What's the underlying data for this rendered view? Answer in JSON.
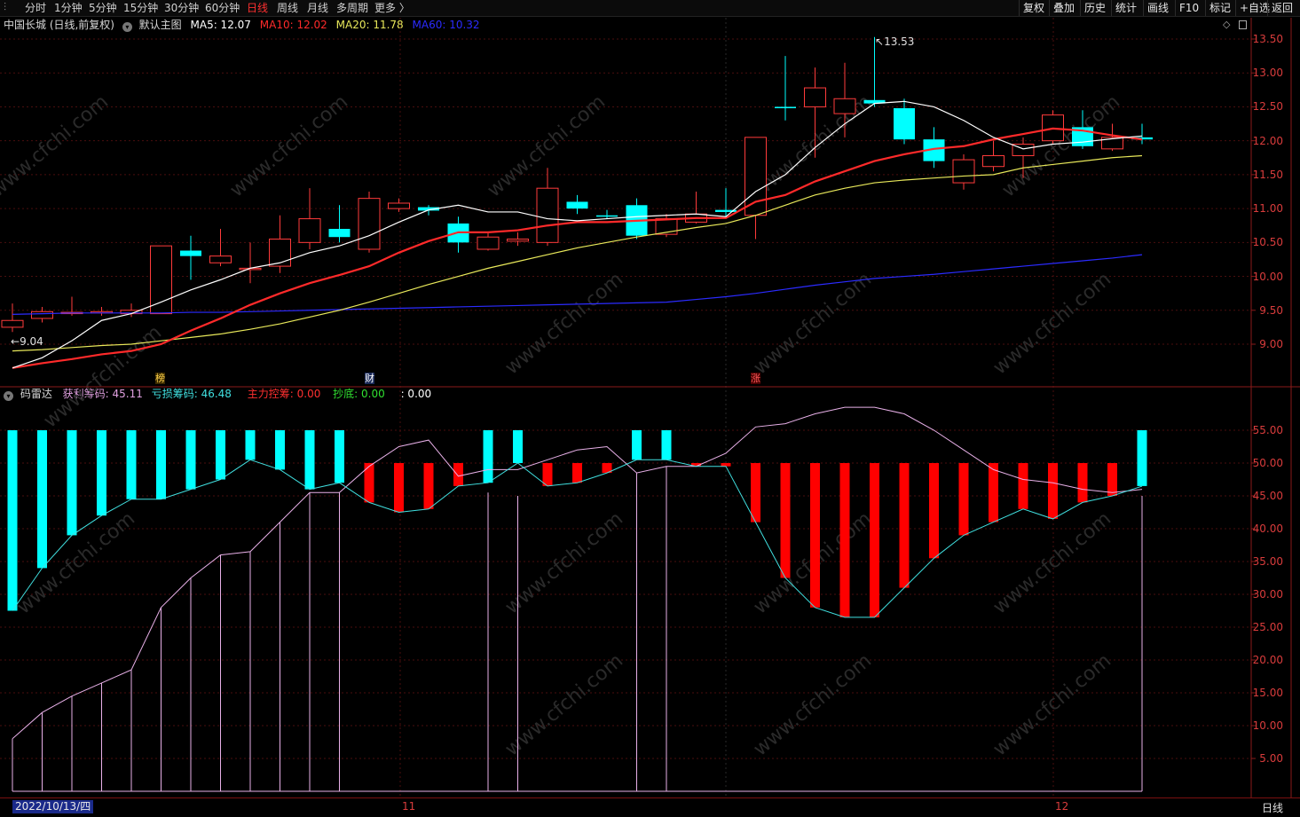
{
  "toolbar": {
    "left_items": [
      "分时",
      "1分钟",
      "5分钟",
      "15分钟",
      "30分钟",
      "60分钟",
      "日线",
      "周线",
      "月线",
      "多周期",
      "更多 〉"
    ],
    "active_period": "日线",
    "right_items": [
      "复权",
      "叠加",
      "历史",
      "统计",
      "画线",
      "F10",
      "标记",
      "+自选",
      "返回"
    ]
  },
  "main_panel": {
    "title": "中国长城 (日线,前复权)",
    "template": "默认主图",
    "ma": [
      {
        "label": "MA5: 12.07",
        "color": "#ffffff"
      },
      {
        "label": "MA10: 12.02",
        "color": "#ff2a2a"
      },
      {
        "label": "MA20: 11.78",
        "color": "#e8e85a"
      },
      {
        "label": "MA60: 10.32",
        "color": "#2b2bff"
      }
    ],
    "high_label": "13.53",
    "low_label": "9.04",
    "markers": [
      "榜",
      "财",
      "涨"
    ],
    "y_ticks": [
      "13.50",
      "13.00",
      "12.50",
      "12.00",
      "11.50",
      "11.00",
      "10.50",
      "10.00",
      "9.50",
      "9.00"
    ]
  },
  "sub_panel": {
    "title": "码雷达",
    "items": [
      {
        "label": "获利筹码: 45.11",
        "color": "#e0a0e0"
      },
      {
        "label": "亏损筹码: 46.48",
        "color": "#40e0e0"
      },
      {
        "label": "主力控筹: 0.00",
        "color": "#ff3030"
      },
      {
        "label": "抄底: 0.00",
        "color": "#30e030"
      },
      {
        "label": ": 0.00",
        "color": "#ffffff"
      }
    ],
    "y_ticks": [
      "55.00",
      "50.00",
      "45.00",
      "40.00",
      "35.00",
      "30.00",
      "25.00",
      "20.00",
      "15.00",
      "10.00",
      "5.00"
    ]
  },
  "bottom_bar": {
    "date": "2022/10/13/四",
    "month_11": "11",
    "month_12": "12",
    "period": "日线"
  },
  "watermark": "www.cfchi.com",
  "colors": {
    "up": "#ff3b3b",
    "down": "#00ffff",
    "grid": "#4a0e0e",
    "axis": "#8a1a1a"
  },
  "chart_data": {
    "type": "candlestick",
    "price_ylim": [
      8.6,
      13.7
    ],
    "candles": [
      {
        "o": 9.25,
        "c": 9.35,
        "h": 9.6,
        "l": 9.18
      },
      {
        "o": 9.38,
        "c": 9.48,
        "h": 9.55,
        "l": 9.32
      },
      {
        "o": 9.46,
        "c": 9.47,
        "h": 9.7,
        "l": 9.42
      },
      {
        "o": 9.46,
        "c": 9.48,
        "h": 9.55,
        "l": 9.42
      },
      {
        "o": 9.45,
        "c": 9.5,
        "h": 9.6,
        "l": 9.4
      },
      {
        "o": 9.45,
        "c": 10.45,
        "h": 10.45,
        "l": 9.45
      },
      {
        "o": 10.38,
        "c": 10.3,
        "h": 10.6,
        "l": 9.95
      },
      {
        "o": 10.2,
        "c": 10.3,
        "h": 10.7,
        "l": 10.15
      },
      {
        "o": 10.1,
        "c": 10.12,
        "h": 10.5,
        "l": 9.9
      },
      {
        "o": 10.15,
        "c": 10.55,
        "h": 10.9,
        "l": 10.05
      },
      {
        "o": 10.5,
        "c": 10.85,
        "h": 11.3,
        "l": 10.4
      },
      {
        "o": 10.7,
        "c": 10.58,
        "h": 11.05,
        "l": 10.5
      },
      {
        "o": 10.4,
        "c": 11.15,
        "h": 11.25,
        "l": 10.35
      },
      {
        "o": 11.0,
        "c": 11.08,
        "h": 11.15,
        "l": 10.95
      },
      {
        "o": 11.02,
        "c": 10.97,
        "h": 11.05,
        "l": 10.9
      },
      {
        "o": 10.78,
        "c": 10.5,
        "h": 10.88,
        "l": 10.35
      },
      {
        "o": 10.4,
        "c": 10.58,
        "h": 10.65,
        "l": 10.38
      },
      {
        "o": 10.52,
        "c": 10.55,
        "h": 10.65,
        "l": 10.45
      },
      {
        "o": 10.5,
        "c": 11.3,
        "h": 11.6,
        "l": 10.45
      },
      {
        "o": 11.1,
        "c": 11.0,
        "h": 11.2,
        "l": 10.92
      },
      {
        "o": 10.9,
        "c": 10.88,
        "h": 10.98,
        "l": 10.85
      },
      {
        "o": 11.05,
        "c": 10.6,
        "h": 11.15,
        "l": 10.55
      },
      {
        "o": 10.62,
        "c": 10.85,
        "h": 10.92,
        "l": 10.58
      },
      {
        "o": 10.8,
        "c": 10.92,
        "h": 11.25,
        "l": 10.78
      },
      {
        "o": 10.98,
        "c": 10.95,
        "h": 11.3,
        "l": 10.85
      },
      {
        "o": 10.9,
        "c": 12.05,
        "h": 12.05,
        "l": 10.55
      },
      {
        "o": 12.5,
        "c": 12.48,
        "h": 13.25,
        "l": 12.3
      },
      {
        "o": 12.5,
        "c": 12.78,
        "h": 13.08,
        "l": 11.75
      },
      {
        "o": 12.4,
        "c": 12.62,
        "h": 13.15,
        "l": 12.05
      },
      {
        "o": 12.6,
        "c": 12.55,
        "h": 13.53,
        "l": 12.5
      },
      {
        "o": 12.48,
        "c": 12.02,
        "h": 12.62,
        "l": 11.95
      },
      {
        "o": 12.02,
        "c": 11.7,
        "h": 12.2,
        "l": 11.6
      },
      {
        "o": 11.38,
        "c": 11.72,
        "h": 11.8,
        "l": 11.28
      },
      {
        "o": 11.62,
        "c": 11.78,
        "h": 12.0,
        "l": 11.55
      },
      {
        "o": 11.78,
        "c": 11.95,
        "h": 12.05,
        "l": 11.45
      },
      {
        "o": 12.0,
        "c": 12.38,
        "h": 12.45,
        "l": 11.95
      },
      {
        "o": 12.2,
        "c": 11.92,
        "h": 12.45,
        "l": 11.88
      },
      {
        "o": 11.88,
        "c": 12.05,
        "h": 12.25,
        "l": 11.85
      },
      {
        "o": 12.05,
        "c": 12.02,
        "h": 12.25,
        "l": 11.95
      }
    ],
    "ma5": [
      8.65,
      8.8,
      9.05,
      9.35,
      9.45,
      9.62,
      9.8,
      9.95,
      10.12,
      10.2,
      10.35,
      10.45,
      10.6,
      10.8,
      10.98,
      11.05,
      10.95,
      10.95,
      10.85,
      10.82,
      10.85,
      10.88,
      10.9,
      10.92,
      10.88,
      11.25,
      11.5,
      11.9,
      12.25,
      12.55,
      12.58,
      12.5,
      12.3,
      12.05,
      11.88,
      11.95,
      11.98,
      12.03,
      12.07
    ],
    "ma10": [
      8.65,
      8.72,
      8.78,
      8.85,
      8.9,
      9.0,
      9.2,
      9.38,
      9.58,
      9.75,
      9.9,
      10.02,
      10.15,
      10.35,
      10.52,
      10.65,
      10.65,
      10.68,
      10.75,
      10.8,
      10.8,
      10.82,
      10.84,
      10.86,
      10.86,
      11.1,
      11.2,
      11.4,
      11.55,
      11.7,
      11.8,
      11.88,
      11.92,
      12.02,
      12.1,
      12.18,
      12.15,
      12.08,
      12.02
    ],
    "ma20": [
      8.9,
      8.92,
      8.95,
      8.98,
      9.0,
      9.05,
      9.1,
      9.15,
      9.22,
      9.3,
      9.4,
      9.5,
      9.62,
      9.75,
      9.88,
      10.0,
      10.12,
      10.22,
      10.32,
      10.42,
      10.5,
      10.58,
      10.65,
      10.72,
      10.78,
      10.9,
      11.05,
      11.2,
      11.3,
      11.38,
      11.42,
      11.45,
      11.48,
      11.5,
      11.6,
      11.65,
      11.7,
      11.75,
      11.78
    ],
    "ma60": [
      9.44,
      9.45,
      9.46,
      9.46,
      9.46,
      9.46,
      9.47,
      9.47,
      9.48,
      9.49,
      9.5,
      9.51,
      9.52,
      9.53,
      9.54,
      9.55,
      9.56,
      9.57,
      9.58,
      9.59,
      9.6,
      9.61,
      9.62,
      9.66,
      9.7,
      9.75,
      9.81,
      9.87,
      9.92,
      9.97,
      10.0,
      10.03,
      10.07,
      10.11,
      10.15,
      10.19,
      10.23,
      10.27,
      10.32
    ],
    "sub_ylim": [
      0,
      60
    ],
    "bars": [
      {
        "top": 55,
        "bottom": 27.5,
        "color": "cyan"
      },
      {
        "top": 55,
        "bottom": 34,
        "color": "cyan"
      },
      {
        "top": 55,
        "bottom": 39,
        "color": "cyan"
      },
      {
        "top": 55,
        "bottom": 42,
        "color": "cyan"
      },
      {
        "top": 55,
        "bottom": 44.5,
        "color": "cyan"
      },
      {
        "top": 55,
        "bottom": 44.5,
        "color": "cyan"
      },
      {
        "top": 55,
        "bottom": 46,
        "color": "cyan"
      },
      {
        "top": 55,
        "bottom": 47.5,
        "color": "cyan"
      },
      {
        "top": 55,
        "bottom": 50.5,
        "color": "cyan"
      },
      {
        "top": 55,
        "bottom": 49,
        "color": "cyan"
      },
      {
        "top": 55,
        "bottom": 46,
        "color": "cyan"
      },
      {
        "top": 55,
        "bottom": 47,
        "color": "cyan"
      },
      {
        "top": 50,
        "bottom": 44,
        "color": "red"
      },
      {
        "top": 50,
        "bottom": 42.5,
        "color": "red"
      },
      {
        "top": 50,
        "bottom": 43,
        "color": "red"
      },
      {
        "top": 50,
        "bottom": 46.5,
        "color": "red"
      },
      {
        "top": 55,
        "bottom": 47,
        "color": "cyan"
      },
      {
        "top": 55,
        "bottom": 50,
        "color": "cyan"
      },
      {
        "top": 50,
        "bottom": 46.5,
        "color": "red"
      },
      {
        "top": 50,
        "bottom": 47,
        "color": "red"
      },
      {
        "top": 50,
        "bottom": 48.5,
        "color": "red"
      },
      {
        "top": 55,
        "bottom": 50.5,
        "color": "cyan"
      },
      {
        "top": 55,
        "bottom": 50.5,
        "color": "cyan"
      },
      {
        "top": 50,
        "bottom": 49.5,
        "color": "red"
      },
      {
        "top": 50,
        "bottom": 49.5,
        "color": "red"
      },
      {
        "top": 50,
        "bottom": 41,
        "color": "red"
      },
      {
        "top": 50,
        "bottom": 32.5,
        "color": "red"
      },
      {
        "top": 50,
        "bottom": 28,
        "color": "red"
      },
      {
        "top": 50,
        "bottom": 26.5,
        "color": "red"
      },
      {
        "top": 50,
        "bottom": 26.5,
        "color": "red"
      },
      {
        "top": 50,
        "bottom": 31,
        "color": "red"
      },
      {
        "top": 50,
        "bottom": 35.5,
        "color": "red"
      },
      {
        "top": 50,
        "bottom": 39,
        "color": "red"
      },
      {
        "top": 50,
        "bottom": 41,
        "color": "red"
      },
      {
        "top": 50,
        "bottom": 43,
        "color": "red"
      },
      {
        "top": 50,
        "bottom": 41.5,
        "color": "red"
      },
      {
        "top": 50,
        "bottom": 44,
        "color": "red"
      },
      {
        "top": 50,
        "bottom": 45,
        "color": "red"
      },
      {
        "top": 55,
        "bottom": 46.5,
        "color": "cyan"
      }
    ],
    "profit": [
      8,
      12,
      14.5,
      16.5,
      18.5,
      28,
      32.5,
      36,
      36.5,
      41,
      45.5,
      45.5,
      49.5,
      52.5,
      53.5,
      48,
      49,
      49,
      50.5,
      52,
      52.5,
      48.5,
      49.5,
      49.5,
      51.5,
      55.5,
      56,
      57.5,
      58.5,
      58.5,
      57.5,
      55,
      52,
      49,
      47.5,
      47,
      46,
      45.5,
      46,
      45.11
    ],
    "profit_lines": [
      8,
      12,
      14.5,
      16.5,
      18.5,
      28,
      32.5,
      36,
      36.5,
      41,
      45.5,
      45.5,
      0,
      0,
      0,
      0,
      45.5,
      45,
      0,
      0,
      0,
      48.5,
      49.5,
      0,
      0,
      0,
      0,
      0,
      0,
      0,
      0,
      0,
      0,
      0,
      0,
      0,
      0,
      0,
      45
    ],
    "loss": [
      27.5,
      34,
      39,
      42,
      44.5,
      44.5,
      46,
      47.5,
      50.5,
      49,
      46,
      47,
      44,
      42.5,
      43,
      46.5,
      47,
      50,
      46.5,
      47,
      48.5,
      50.5,
      50.5,
      49.5,
      49.5,
      41,
      32.5,
      28,
      26.5,
      26.5,
      31,
      35.5,
      39,
      41,
      43,
      41.5,
      44,
      45,
      46.48
    ]
  }
}
